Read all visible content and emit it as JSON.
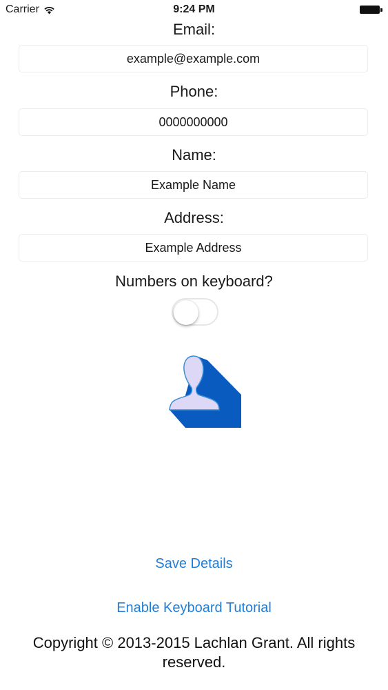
{
  "status_bar": {
    "carrier": "Carrier",
    "wifi_icon": "wifi-icon",
    "time": "9:24 PM",
    "battery_icon": "battery-icon"
  },
  "form": {
    "email_label": "Email:",
    "email_value": "example@example.com",
    "phone_label": "Phone:",
    "phone_value": "0000000000",
    "name_label": "Name:",
    "name_value": "Example Name",
    "address_label": "Address:",
    "address_value": "Example Address",
    "numbers_label": "Numbers on keyboard?",
    "numbers_toggle_on": false
  },
  "contact_icon": {
    "name": "contact-person-icon",
    "fill_color": "#dcd8f5",
    "outline_color": "#3a8fd8",
    "shadow_color": "#0a5bbf"
  },
  "actions": {
    "save_label": "Save Details",
    "tutorial_label": "Enable Keyboard Tutorial",
    "link_color": "#1f7fd6"
  },
  "footer": {
    "copyright": "Copyright © 2013-2015 Lachlan Grant. All rights reserved."
  }
}
